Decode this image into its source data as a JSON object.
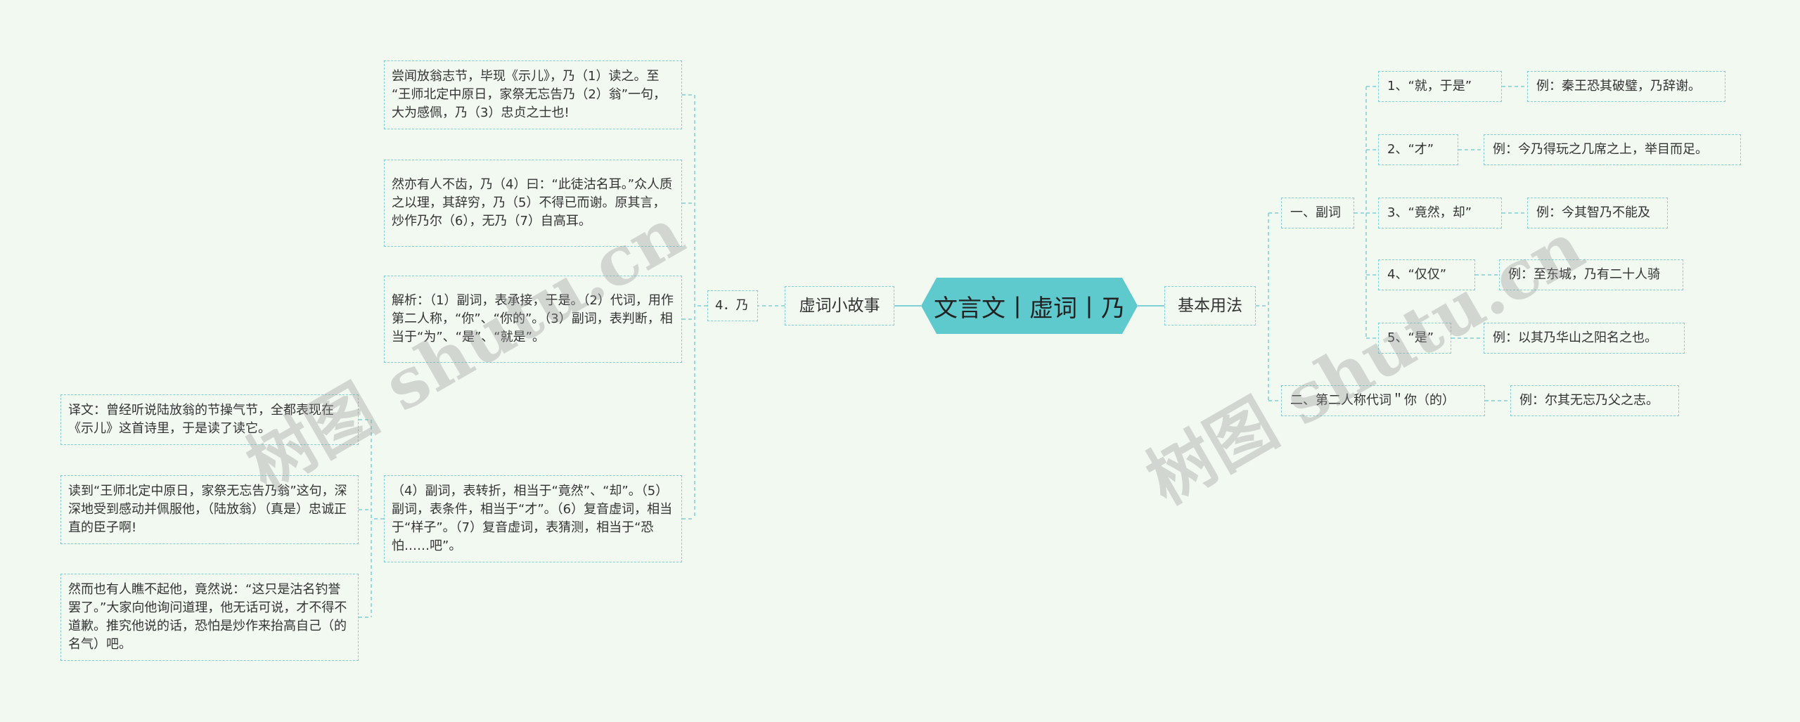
{
  "root": "文言文丨虚词丨乃",
  "left": {
    "branch": "虚词小故事",
    "sub": "4．乃",
    "texts": [
      "尝闻放翁志节，毕现《示儿》，乃（1）读之。至 “王师北定中原日，家祭无忘告乃（2）翁”一句，大为感佩，乃（3）忠贞之士也!",
      "然亦有人不齿，乃（4）曰：“此徒沽名耳。”众人质之以理，其辞穷，乃（5）不得已而谢。原其言，炒作乃尔（6），无乃（7）自高耳。",
      "解析：（1）副词，表承接，于是。（2）代词，用作第二人称，“你”、“你的”。（3）副词，表判断，相当于“为”、“是”、“就是”。",
      "（4）副词，表转折，相当于“竟然”、“却”。（5）副词，表条件，相当于“才”。（6）复音虚词，相当于“样子”。（7）复音虚词，表猜测，相当于“恐怕……吧”。"
    ],
    "translations": [
      "译文：曾经听说陆放翁的节操气节，全都表现在《示儿》这首诗里，于是读了读它。",
      "读到“王师北定中原日，家祭无忘告乃翁”这句，深深地受到感动并佩服他，（陆放翁）（真是）忠诚正直的臣子啊!",
      "然而也有人瞧不起他，竟然说：“这只是沽名钓誉罢了。”大家向他询问道理，他无话可说，才不得不道歉。推究他说的话，恐怕是炒作来抬高自己（的名气）吧。"
    ]
  },
  "right": {
    "branch": "基本用法",
    "cat1": "一、副词",
    "cat2": "二、第二人称代词＂你（的）",
    "items": [
      {
        "label": "1、“就，于是”",
        "example": "例：秦王恐其破璧，乃辞谢。"
      },
      {
        "label": "2、“才”",
        "example": "例：今乃得玩之几席之上，举目而足。"
      },
      {
        "label": "3、“竟然，却”",
        "example": "例：今其智乃不能及"
      },
      {
        "label": "4、“仅仅”",
        "example": "例：至东城，乃有二十人骑"
      },
      {
        "label": "5、“是”",
        "example": "例：以其乃华山之阳名之也。"
      }
    ],
    "cat2_example": "例：尔其无忘乃父之志。"
  },
  "watermarks": [
    "树图 shutu.cn",
    "树图 shutu.cn"
  ],
  "colors": {
    "line": "#7ecfd6",
    "root_fill": "#5ecacd",
    "background": "#f1f9f1"
  }
}
